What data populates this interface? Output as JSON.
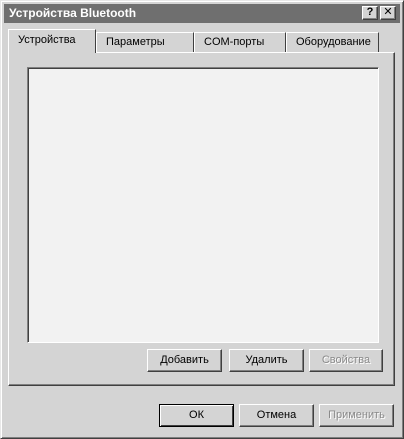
{
  "window": {
    "title": "Устройства Bluetooth",
    "help_glyph": "?",
    "close_glyph": "✕"
  },
  "tabs": [
    {
      "label": "Устройства",
      "active": true
    },
    {
      "label": "Параметры",
      "active": false
    },
    {
      "label": "COM-порты",
      "active": false
    },
    {
      "label": "Оборудование",
      "active": false
    }
  ],
  "devices_panel": {
    "buttons": {
      "add": "Добавить",
      "remove": "Удалить",
      "properties": "Свойства"
    }
  },
  "footer": {
    "ok": "ОК",
    "cancel": "Отмена",
    "apply": "Применить"
  }
}
